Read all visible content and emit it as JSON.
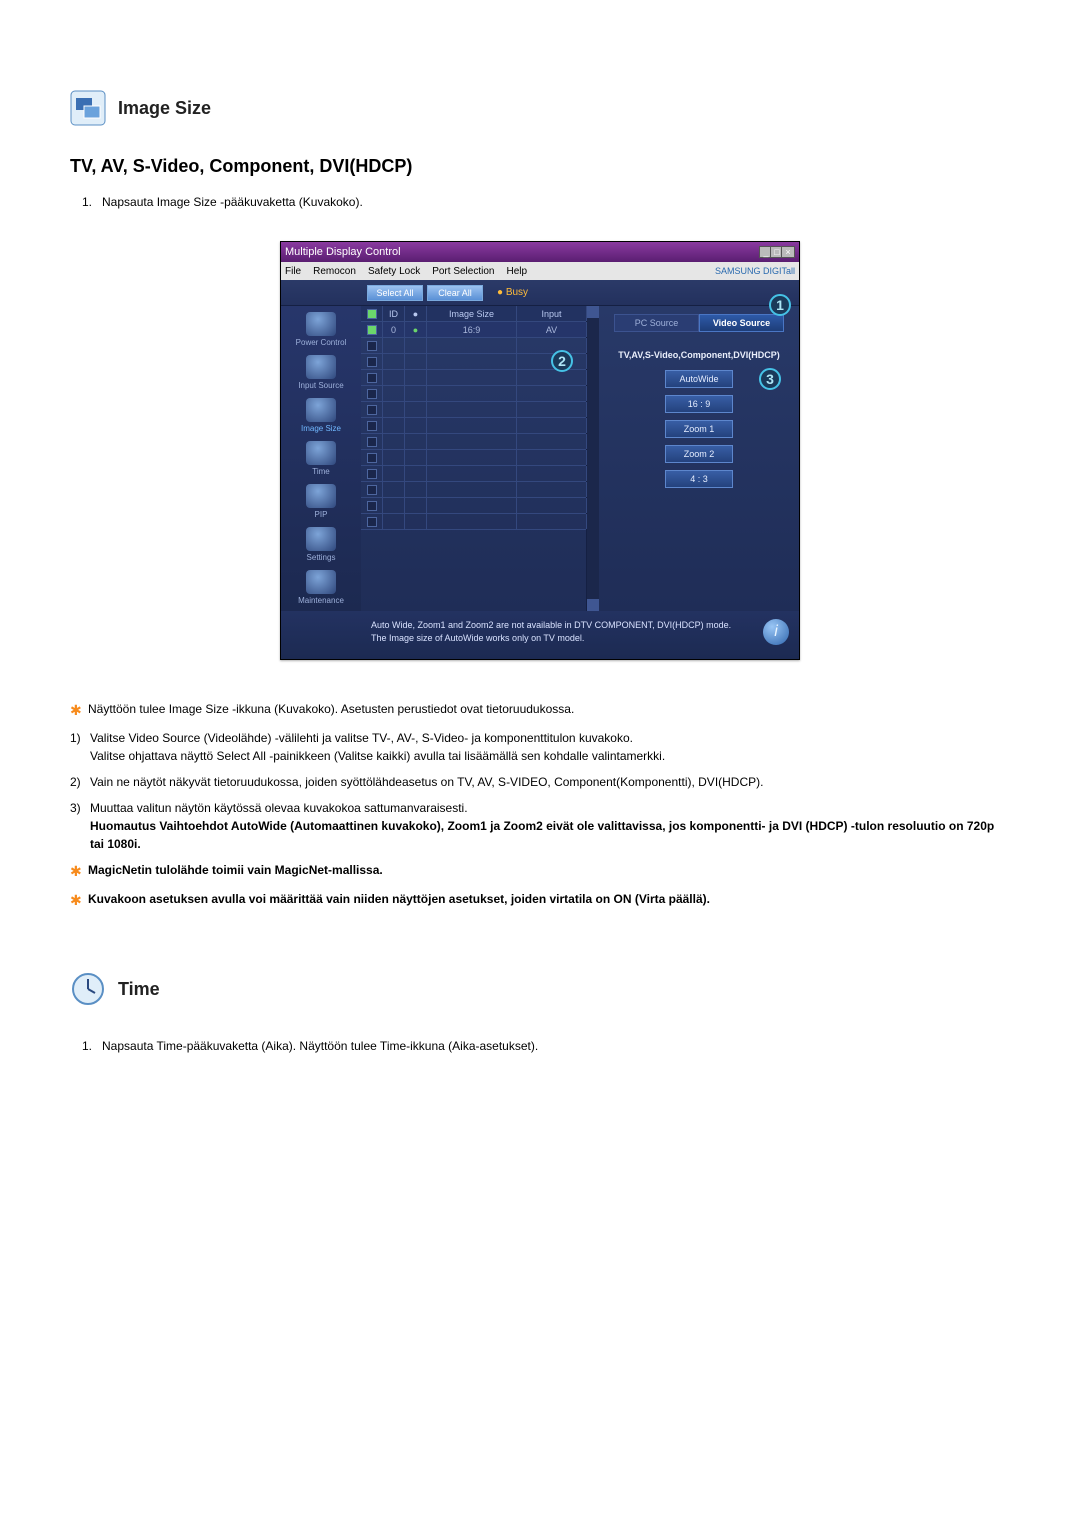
{
  "section1": {
    "title": "Image Size",
    "subtitle": "TV, AV, S-Video, Component, DVI(HDCP)",
    "intro_item": "Napsauta Image Size -pääkuvaketta (Kuvakoko)."
  },
  "app": {
    "window_title": "Multiple Display Control",
    "menu": {
      "file": "File",
      "remocon": "Remocon",
      "safety": "Safety Lock",
      "port": "Port Selection",
      "help": "Help"
    },
    "brand": "SAMSUNG DIGITall",
    "select_all": "Select All",
    "clear_all": "Clear All",
    "busy": "Busy",
    "sidebar": {
      "power": "Power Control",
      "input": "Input Source",
      "image": "Image Size",
      "time": "Time",
      "pip": "PIP",
      "settings": "Settings",
      "maintenance": "Maintenance"
    },
    "table": {
      "h_id": "ID",
      "h_size": "Image Size",
      "h_input": "Input",
      "row0_id": "0",
      "row0_size": "16:9",
      "row0_input": "AV"
    },
    "tabs": {
      "pc": "PC Source",
      "video": "Video Source"
    },
    "panel_title": "TV,AV,S-Video,Component,DVI(HDCP)",
    "options": {
      "autowide": "AutoWide",
      "r169": "16 : 9",
      "zoom1": "Zoom 1",
      "zoom2": "Zoom 2",
      "r43": "4 : 3"
    },
    "footer_l1": "Auto Wide, Zoom1 and Zoom2 are not available in DTV COMPONENT, DVI(HDCP) mode.",
    "footer_l2": "The Image size of AutoWide works only on TV model."
  },
  "callouts": {
    "c1": "1",
    "c2": "2",
    "c3": "3"
  },
  "notes": {
    "n0": "Näyttöön tulee Image Size -ikkuna (Kuvakoko). Asetusten perustiedot ovat tietoruudukossa.",
    "n1a": "Valitse Video Source (Videolähde) -välilehti ja valitse TV-, AV-, S-Video- ja komponenttitulon kuvakoko.",
    "n1b": "Valitse ohjattava näyttö Select All -painikkeen (Valitse kaikki) avulla tai lisäämällä sen kohdalle valintamerkki.",
    "n2": "Vain ne näytöt näkyvät tietoruudukossa, joiden syöttölähdeasetus on TV, AV, S-VIDEO, Component(Komponentti), DVI(HDCP).",
    "n3": "Muuttaa valitun näytön käytössä olevaa kuvakokoa sattumanvaraisesti.",
    "n3b": "Huomautus Vaihtoehdot AutoWide (Automaattinen kuvakoko), Zoom1 ja Zoom2 eivät ole valittavissa, jos komponentti- ja DVI (HDCP) -tulon resoluutio on 720p tai 1080i.",
    "s1": "MagicNetin tulolähde toimii vain MagicNet-mallissa.",
    "s2": "Kuvakoon asetuksen avulla voi määrittää vain niiden näyttöjen asetukset, joiden virtatila on ON (Virta päällä)."
  },
  "section2": {
    "title": "Time",
    "intro": "Napsauta Time-pääkuvaketta (Aika). Näyttöön tulee Time-ikkuna (Aika-asetukset)."
  }
}
